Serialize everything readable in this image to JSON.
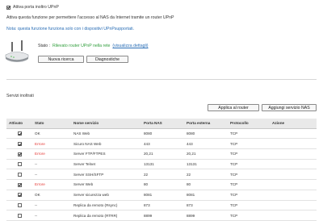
{
  "upnp": {
    "enable_label": "Attiva porta inoltro UPnP",
    "enable_checked": true,
    "description": "Attiva questa funzione per permettere l'accesso al NAS da Internet tramite un router UPnP",
    "note": "Nota: questa funzione funziona solo con i dispositivi UPnPsupportati.",
    "status_prefix": "Stato :",
    "status_text": "Rilevato router UPnP nella rete",
    "status_link": "(visualizza dettagli)",
    "status_color": "#2e9d3a",
    "rescan_label": "Nuova ricerca",
    "diagnostics_label": "Diagnostiche",
    "router_icon": "router-icon"
  },
  "services": {
    "section_title": "Servizi inoltrati",
    "apply_label": "Applica al router",
    "add_label": "Aggiungi servizio NAS",
    "columns": [
      "Attivato",
      "Stato",
      "Nome servizio",
      "Porta NAS",
      "Porta esterna",
      "Protocollo",
      "Azione"
    ],
    "rows": [
      {
        "checked": true,
        "status": "OK",
        "name": "NAS Web",
        "nas_port": "8080",
        "ext_port": "8080",
        "protocol": "TCP",
        "action": ""
      },
      {
        "checked": true,
        "status": "Errore",
        "name": "Sicuro NAS Web",
        "nas_port": "443",
        "ext_port": "443",
        "protocol": "TCP",
        "action": ""
      },
      {
        "checked": true,
        "status": "Errore",
        "name": "Server FTP/FTPES",
        "nas_port": "20,21",
        "ext_port": "20,21",
        "protocol": "TCP",
        "action": ""
      },
      {
        "checked": false,
        "status": "--",
        "name": "Server Telnet",
        "nas_port": "13131",
        "ext_port": "13131",
        "protocol": "TCP",
        "action": ""
      },
      {
        "checked": false,
        "status": "--",
        "name": "Server SSH/SFTP",
        "nas_port": "22",
        "ext_port": "22",
        "protocol": "TCP",
        "action": ""
      },
      {
        "checked": true,
        "status": "Errore",
        "name": "Server Web",
        "nas_port": "80",
        "ext_port": "80",
        "protocol": "TCP",
        "action": ""
      },
      {
        "checked": true,
        "status": "OK",
        "name": "Server sicurezza web",
        "nas_port": "8081",
        "ext_port": "8081",
        "protocol": "TCP",
        "action": ""
      },
      {
        "checked": false,
        "status": "--",
        "name": "Replica da remoto (Rsync)",
        "nas_port": "873",
        "ext_port": "873",
        "protocol": "TCP",
        "action": ""
      },
      {
        "checked": false,
        "status": "--",
        "name": "Replica da remoto (RTRR)",
        "nas_port": "8899",
        "ext_port": "8899",
        "protocol": "TCP",
        "action": ""
      }
    ]
  }
}
